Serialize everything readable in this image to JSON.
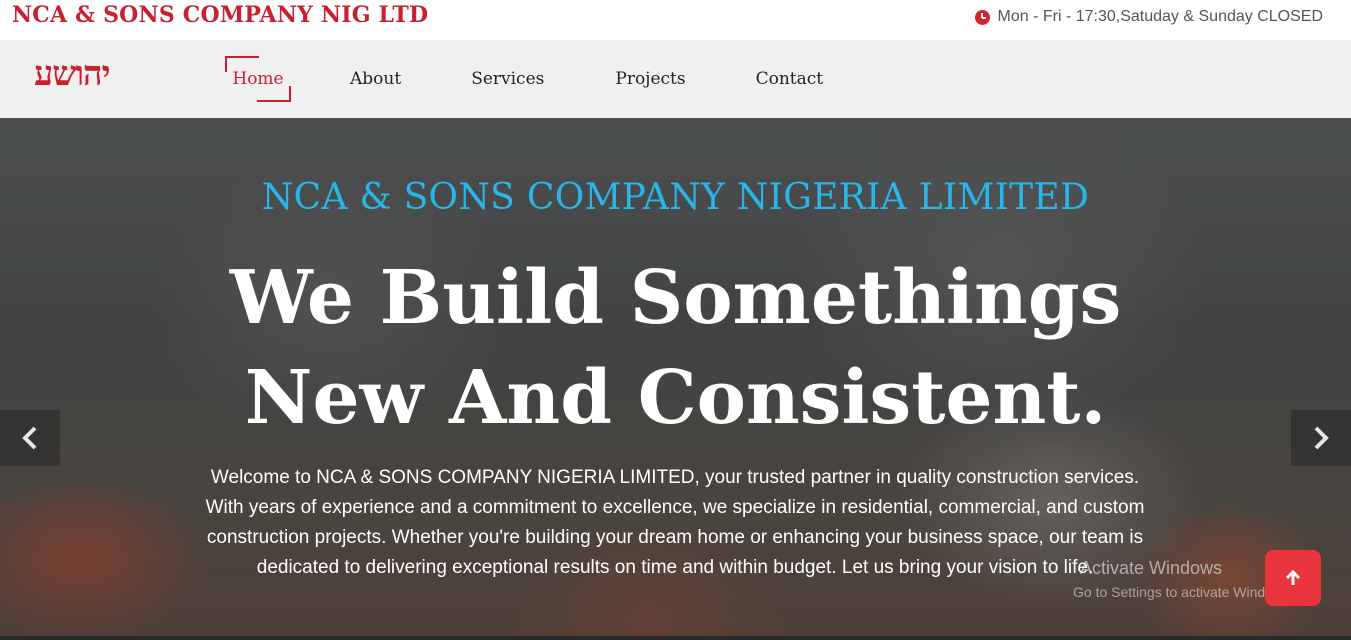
{
  "topbar": {
    "brand": "NCA & SONS COMPANY NIG LTD",
    "hours_icon": "clock-icon",
    "hours": "Mon - Fri - 17:30,Satuday & Sunday CLOSED"
  },
  "navbar": {
    "logo": "יהושע",
    "items": [
      {
        "label": "Home",
        "active": true
      },
      {
        "label": "About"
      },
      {
        "label": "Services"
      },
      {
        "label": "Projects"
      },
      {
        "label": "Contact"
      }
    ],
    "accent_color": "#c8202f"
  },
  "hero": {
    "eyebrow": "NCA & SONS COMPANY NIGERIA LIMITED",
    "title_line1": "We Build Somethings",
    "title_line2": "New And Consistent.",
    "body": "Welcome to NCA & SONS COMPANY NIGERIA LIMITED, your trusted partner in quality construction services. With years of experience and a commitment to excellence, we specialize in residential, commercial, and custom construction projects. Whether you're building your dream home or enhancing your business space, our team is dedicated to delivering exceptional results on time and within budget. Let us bring your vision to life.",
    "prev_icon": "chevron-left-icon",
    "next_icon": "chevron-right-icon",
    "eyebrow_color": "#29b6e8"
  },
  "overlay": {
    "watermark_title": "Activate Windows",
    "watermark_sub": "Go to Settings to activate Windows.",
    "to_top_icon": "arrow-up-icon",
    "to_top_color": "#e8343d"
  }
}
